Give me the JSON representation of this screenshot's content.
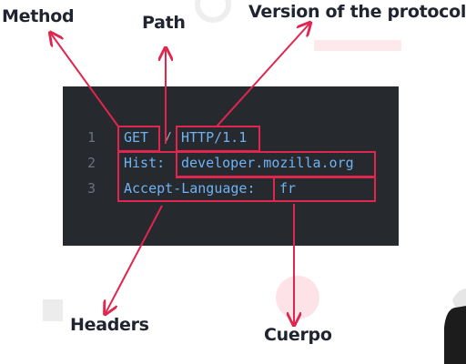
{
  "annotations": {
    "method": "Method",
    "path": "Path",
    "version": "Version of the protocol",
    "headers": "Headers",
    "body": "Cuerpo"
  },
  "code": {
    "lines": [
      {
        "number": "1",
        "method": "GET",
        "separator": "/",
        "version": "HTTP/1.1"
      },
      {
        "number": "2",
        "header_name": "Hist:",
        "header_value": "developer.mozilla.org"
      },
      {
        "number": "3",
        "header_name": "Accept-Language:",
        "header_value": "fr"
      }
    ]
  },
  "colors": {
    "background": "#ffffff",
    "code_background": "#26292e",
    "code_text": "#6fb3f2",
    "line_number": "#6c717a",
    "highlight": "#e0264f",
    "label_text": "#1f2430"
  }
}
